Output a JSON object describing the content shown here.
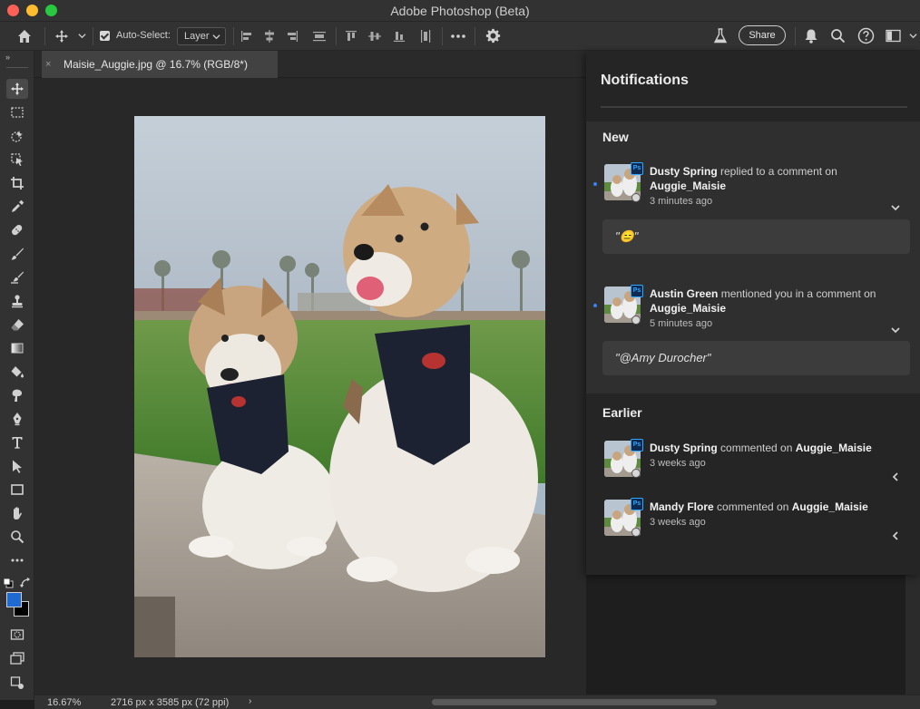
{
  "window": {
    "title": "Adobe Photoshop (Beta)"
  },
  "options_bar": {
    "auto_select_label": "Auto-Select:",
    "auto_select_checked": true,
    "layer_select_value": "Layer",
    "share_label": "Share"
  },
  "document": {
    "tab_title": "Maisie_Auggie.jpg @ 16.7% (RGB/8*)",
    "close_glyph": "×"
  },
  "status_bar": {
    "zoom": "16.67%",
    "dimensions": "2716 px x 3585 px (72 ppi)",
    "arrow": "›"
  },
  "colors": {
    "foreground": "#1f6ad2",
    "background": "#000000",
    "unread_dot": "#3c82f0"
  },
  "notifications": {
    "title": "Notifications",
    "new_label": "New",
    "earlier_label": "Earlier",
    "new_items": [
      {
        "user": "Dusty Spring",
        "action": "replied to a comment on",
        "target": "Auggie_Maisie",
        "time": "3 minutes ago",
        "quote": "\"😑\""
      },
      {
        "user": "Austin Green",
        "action": "mentioned you in a comment on",
        "target": "Auggie_Maisie",
        "time": "5 minutes ago",
        "quote": "\"@Amy Durocher\""
      }
    ],
    "earlier_items": [
      {
        "user": "Dusty Spring",
        "action": "commented on",
        "target": "Auggie_Maisie",
        "time": "3 weeks ago"
      },
      {
        "user": "Mandy Flore",
        "action": "commented on",
        "target": "Auggie_Maisie",
        "time": "3 weeks ago"
      }
    ],
    "app_badge": "Ps"
  },
  "icons": {
    "toolbar": [
      "move-icon",
      "marquee-icon",
      "object-select-icon",
      "frame-select-icon",
      "crop-icon",
      "eyedropper-icon",
      "healing-brush-icon",
      "brush-icon",
      "clone-stamp-icon",
      "history-brush-icon",
      "eraser-icon",
      "gradient-icon",
      "paint-bucket-icon",
      "smudge-icon",
      "pen-icon",
      "type-icon",
      "path-select-icon",
      "rectangle-icon",
      "hand-icon",
      "zoom-icon",
      "more-tools-icon"
    ]
  }
}
